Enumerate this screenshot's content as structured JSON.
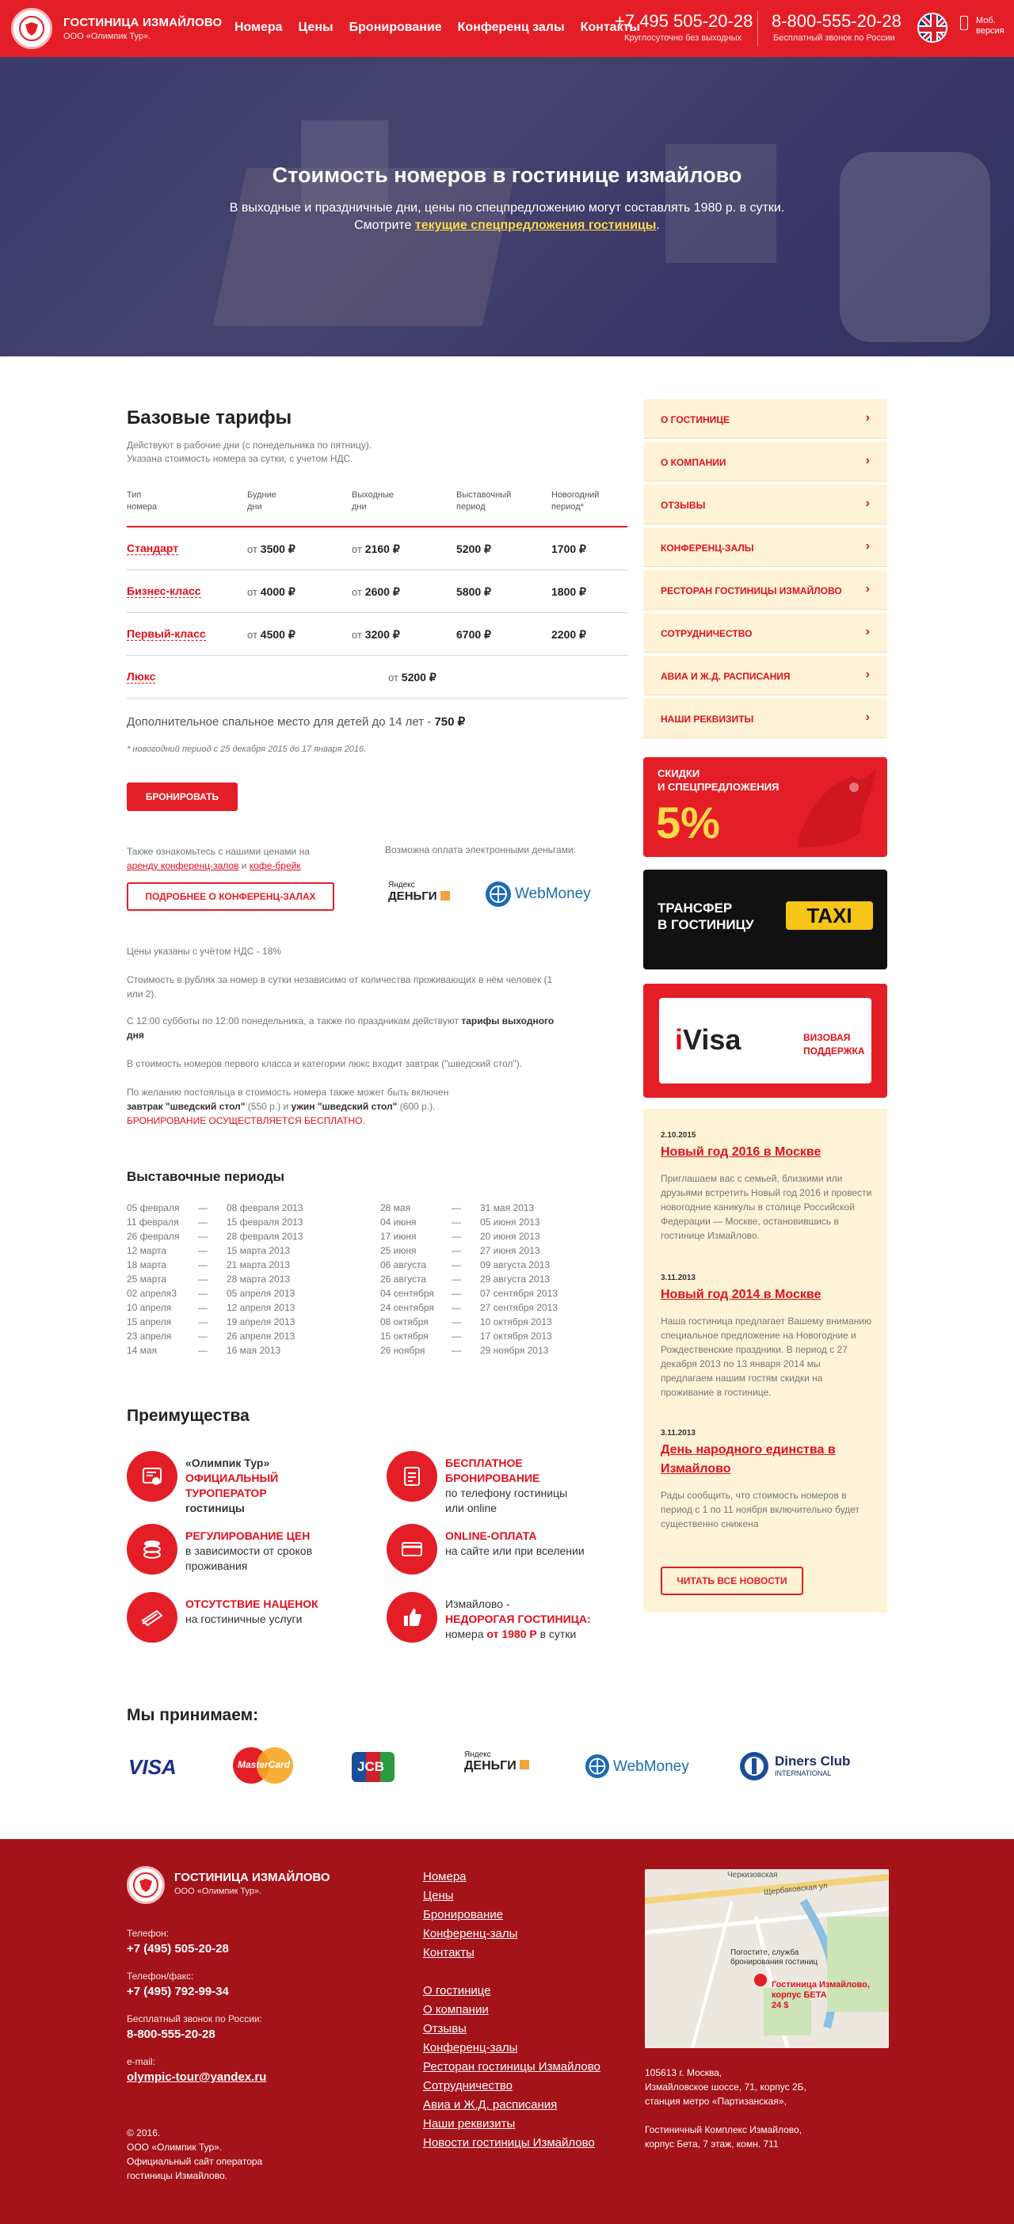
{
  "header": {
    "brand": "ГОСТИНИЦА ИЗМАЙЛОВО",
    "brand_sub": "ООО «Олимпик Тур».",
    "nav": [
      "Номера",
      "Цены",
      "Бронирование",
      "Конференц залы",
      "Контакты"
    ],
    "phone1": "+7 495 505-20-28",
    "phone1_sub": "Круглосуточно без выходных",
    "phone2": "8-800-555-20-28",
    "phone2_sub": "Бесплатный звонок по России",
    "mobile": "Моб.",
    "mobile2": "версия"
  },
  "hero": {
    "title": "Стоимость номеров в гостинице измайлово",
    "line1": "В выходные и праздничные дни, цены по спецпредложению могут составлять 1980 р. в сутки.",
    "line2_pre": "Смотрите ",
    "line2_link": "текущие спецпредложения гостиницы",
    "line2_post": "."
  },
  "tariffs": {
    "title": "Базовые тарифы",
    "note1": "Действуют в рабочие дни (с понедельника по пятницу).",
    "note2": "Указана стоимость номера за сутки, с учетом НДС.",
    "headers": [
      [
        "Тип",
        "номера"
      ],
      [
        "Будние",
        "дни"
      ],
      [
        "Выходные",
        "дни"
      ],
      [
        "Выставочный",
        "период"
      ],
      [
        "Новогодний",
        "период*"
      ]
    ],
    "rows": [
      {
        "name": "Стандарт",
        "from1": "от",
        "weekday": "3500 ₽",
        "from2": "от",
        "weekend": "2160 ₽",
        "exhib": "5200 ₽",
        "ny": "1700 ₽"
      },
      {
        "name": "Бизнес-класс",
        "from1": "от",
        "weekday": "4000 ₽",
        "from2": "от",
        "weekend": "2600 ₽",
        "exhib": "5800 ₽",
        "ny": "1800 ₽"
      },
      {
        "name": "Первый-класс",
        "from1": "от",
        "weekday": "4500 ₽",
        "from2": "от",
        "weekend": "3200 ₽",
        "exhib": "6700 ₽",
        "ny": "2200 ₽"
      },
      {
        "name": "Люкс",
        "from1": "от",
        "weekday": "5200 ₽",
        "from2": "",
        "weekend": "",
        "exhib": "",
        "ny": ""
      }
    ],
    "extra": "Дополнительное спальное место для детей до 14 лет - ",
    "extra_price": "750 ₽",
    "ny_note": "* новогодний период с 25 декабря 2015 до 17 января 2016.",
    "book_btn": "БРОНИРОВАТЬ"
  },
  "also": {
    "text1": "Также ознакомьтесь с нашими ценами на",
    "link1": "аренду конференц-залов",
    "and": " и ",
    "link2": "кофе-брейк",
    "btn": "ПОДРОБНЕЕ О КОНФЕРЕНЦ-ЗАЛАХ",
    "pay_text": "Возможна оплата электронными деньгами:",
    "yandex1": "Яндекс",
    "yandex2": "ДЕНЬГИ",
    "webmoney": "WebMoney"
  },
  "info": {
    "p1": "Цены указаны с учётом НДС - 18%",
    "p2": "Стоимость в рублях за номер в сутки независимо от количества проживающих в нём человек (1 или 2).",
    "p3a": "С 12:00 субботы по 12:00 понедельника, а также по праздникам действуют ",
    "p3b": "тарифы выходного дня",
    "p4": "В стоимость номеров первого класса и категории люкс входит завтрак (\"шведский стол\").",
    "p5a": "По желанию постояльца в стоимость номера также может быть включен",
    "p5b": "завтрак \"шведский стол\"",
    "p5c": " (550 р.) и ",
    "p5d": "ужин \"шведский стол\"",
    "p5e": " (600 р.).",
    "p5f": "БРОНИРОВАНИЕ ОСУЩЕСТВЛЯЕТСЯ БЕСПЛАТНО."
  },
  "exhibitions": {
    "title": "Выставочные периоды",
    "dash": "—",
    "left": [
      [
        "05 февраля",
        "08 февраля 2013"
      ],
      [
        "11 февраля",
        "15 февраля 2013"
      ],
      [
        "26 февраля",
        "28 февраля 2013"
      ],
      [
        "12 марта",
        "15 марта 2013"
      ],
      [
        "18 марта",
        "21 марта 2013"
      ],
      [
        "25 марта",
        "28 марта 2013"
      ],
      [
        "02 апреля3",
        "05 апреля 2013"
      ],
      [
        "10 апреля",
        "12 апреля 2013"
      ],
      [
        "15 апреля",
        "19 апреля 2013"
      ],
      [
        "23 апреля",
        "26 апреля 2013"
      ],
      [
        "14 мая",
        "16 мая 2013"
      ]
    ],
    "right": [
      [
        "28 мая",
        "31 мая 2013"
      ],
      [
        "04 июня",
        "05 июня 2013"
      ],
      [
        "17 июня",
        "20 июня 2013"
      ],
      [
        "25 июня",
        "27 июня 2013"
      ],
      [
        "06 августа",
        "09 августа 2013"
      ],
      [
        "26 августа",
        "29 августа 2013"
      ],
      [
        "04 сентября",
        "07 сентября 2013"
      ],
      [
        "24 сентября",
        "27 сентября 2013"
      ],
      [
        "08 октября",
        "10 октября 2013"
      ],
      [
        "15 октября",
        "17 октября 2013"
      ],
      [
        "26 ноября",
        "29 ноября 2013"
      ]
    ]
  },
  "advantages": {
    "title": "Преимущества",
    "items": [
      {
        "l1": "«Олимпик Тур»",
        "l2": "ОФИЦИАЛЬНЫЙ ТУРОПЕРАТОР",
        "l3": "гостиницы",
        "icon": "certificate-icon"
      },
      {
        "l1": "БЕСПЛАТНОЕ БРОНИРОВАНИЕ",
        "l2": "по телефону гостиницы",
        "l3": "или online",
        "icon": "booking-icon"
      },
      {
        "l1": "РЕГУЛИРОВАНИЕ ЦЕН",
        "l2": "в зависимости от сроков",
        "l3": "проживания",
        "icon": "coins-icon"
      },
      {
        "l1": "ONLINE-ОПЛАТА",
        "l2": "на сайте или при вселении",
        "l3": "",
        "icon": "card-icon"
      },
      {
        "l1": "ОТСУТСТВИЕ НАЦЕНОК",
        "l2": "на гостиничные услуги",
        "l3": "",
        "icon": "money-icon"
      },
      {
        "l1": "Измайлово -",
        "l2": "НЕДОРОГАЯ ГОСТИНИЦА:",
        "l3a": "номера ",
        "l3b": "от 1980 Р",
        "l3c": " в сутки",
        "icon": "thumbs-up-icon"
      }
    ]
  },
  "payments": {
    "title": "Мы принимаем:",
    "visa": "VISA",
    "mastercard": "MasterCard",
    "jcb": "JCB",
    "yandex1": "Яндекс",
    "yandex2": "ДЕНЬГИ",
    "webmoney": "WebMoney",
    "diners1": "Diners Club",
    "diners2": "INTERNATIONAL"
  },
  "sidebar": {
    "items": [
      "О ГОСТИНИЦЕ",
      "О КОМПАНИИ",
      "ОТЗЫВЫ",
      "КОНФЕРЕНЦ-ЗАЛЫ",
      "РЕСТОРАН ГОСТИНИЦЫ ИЗМАЙЛОВО",
      "СОТРУДНИЧЕСТВО",
      "АВИА И Ж.Д. РАСПИСАНИЯ",
      "НАШИ РЕКВИЗИТЫ"
    ],
    "promo1_l1": "СКИДКИ",
    "promo1_l2": "И СПЕЦПРЕДЛОЖЕНИЯ",
    "promo1_pct": "5%",
    "promo2_l1": "ТРАНСФЕР",
    "promo2_l2": "В ГОСТИНИЦУ",
    "promo2_taxi": "TAXI",
    "promo3_logo_i": "i",
    "promo3_logo": "Visa",
    "promo3_l1": "ВИЗОВАЯ",
    "promo3_l2": "ПОДДЕРЖКА"
  },
  "news": {
    "items": [
      {
        "date": "2.10.2015",
        "title": "Новый год 2016 в Москве",
        "text": "Приглашаем вас с семьей, близкими или друзьями встретить Новый год 2016 и провести новогодние каникулы в столице Российской Федерации — Москве, остановившись в гостинице Измайлово."
      },
      {
        "date": "3.11.2013",
        "title": "Новый год 2014 в Москве",
        "text": "Наша гостиница предлагает Вашему вниманию специальное предложение на Новогодние и Рождественские праздники. В период с 27 декабря 2013 по 13 января 2014 мы предлагаем нашим гостям скидки на проживание в гостинице."
      },
      {
        "date": "3.11.2013",
        "title": "День народного единства в Измайлово",
        "text": "Рады сообщить, что стоимость номеров в период с 1 по 11 ноября включительно будет существенно снижена"
      }
    ],
    "btn": "ЧИТАТЬ ВСЕ НОВОСТИ"
  },
  "footer": {
    "brand": "ГОСТИНИЦА ИЗМАЙЛОВО",
    "brand_sub": "ООО «Олимпик Тур».",
    "phone_label": "Телефон:",
    "phone": "+7 (495) 505-20-28",
    "fax_label": "Телефон/факс:",
    "fax": "+7 (495) 792-99-34",
    "free_label": "Бесплатный звонок по России:",
    "free": "8-800-555-20-28",
    "email_label": "e-mail:",
    "email": "olympic-tour@yandex.ru",
    "copy1": "© 2016.",
    "copy2": "ООО «Олимпик Тур».",
    "copy3": "Официальный сайт оператора",
    "copy4": "гостиницы Измайлово.",
    "links1": [
      "Номера",
      "Цены",
      "Бронирование",
      "Конференц-залы",
      "Контакты"
    ],
    "links2": [
      "О гостинице",
      "О компании",
      "Отзывы",
      "Конференц-залы",
      "Ресторан гостиницы Измайлово",
      "Сотрудничество",
      "Авиа и Ж.Д. расписания",
      "Наши реквизиты",
      "Новости гостиницы Измайлово"
    ],
    "map_street1": "Черкизовская",
    "map_street2": "Щербаковская ул",
    "map_label1": "Погостите, служба",
    "map_label2": "бронирования гостиниц",
    "map_pin1": "Гостиница Измайлово,",
    "map_pin2": "корпус БЕТА",
    "map_pin3": "24 $",
    "addr1": "105613 г. Москва,",
    "addr2": "Измайловское шоссе, 71, корпус 2Б,",
    "addr3": "станция метро «Партизанская»,",
    "addr4": "Гостиничный Комплекс Измайлово,",
    "addr5": "корпус Бета, 7 этаж, комн. 711"
  },
  "colors": {
    "brand_red": "#e41e26",
    "footer_red": "#a4121a",
    "sidebar_bg": "#fef3d6"
  }
}
